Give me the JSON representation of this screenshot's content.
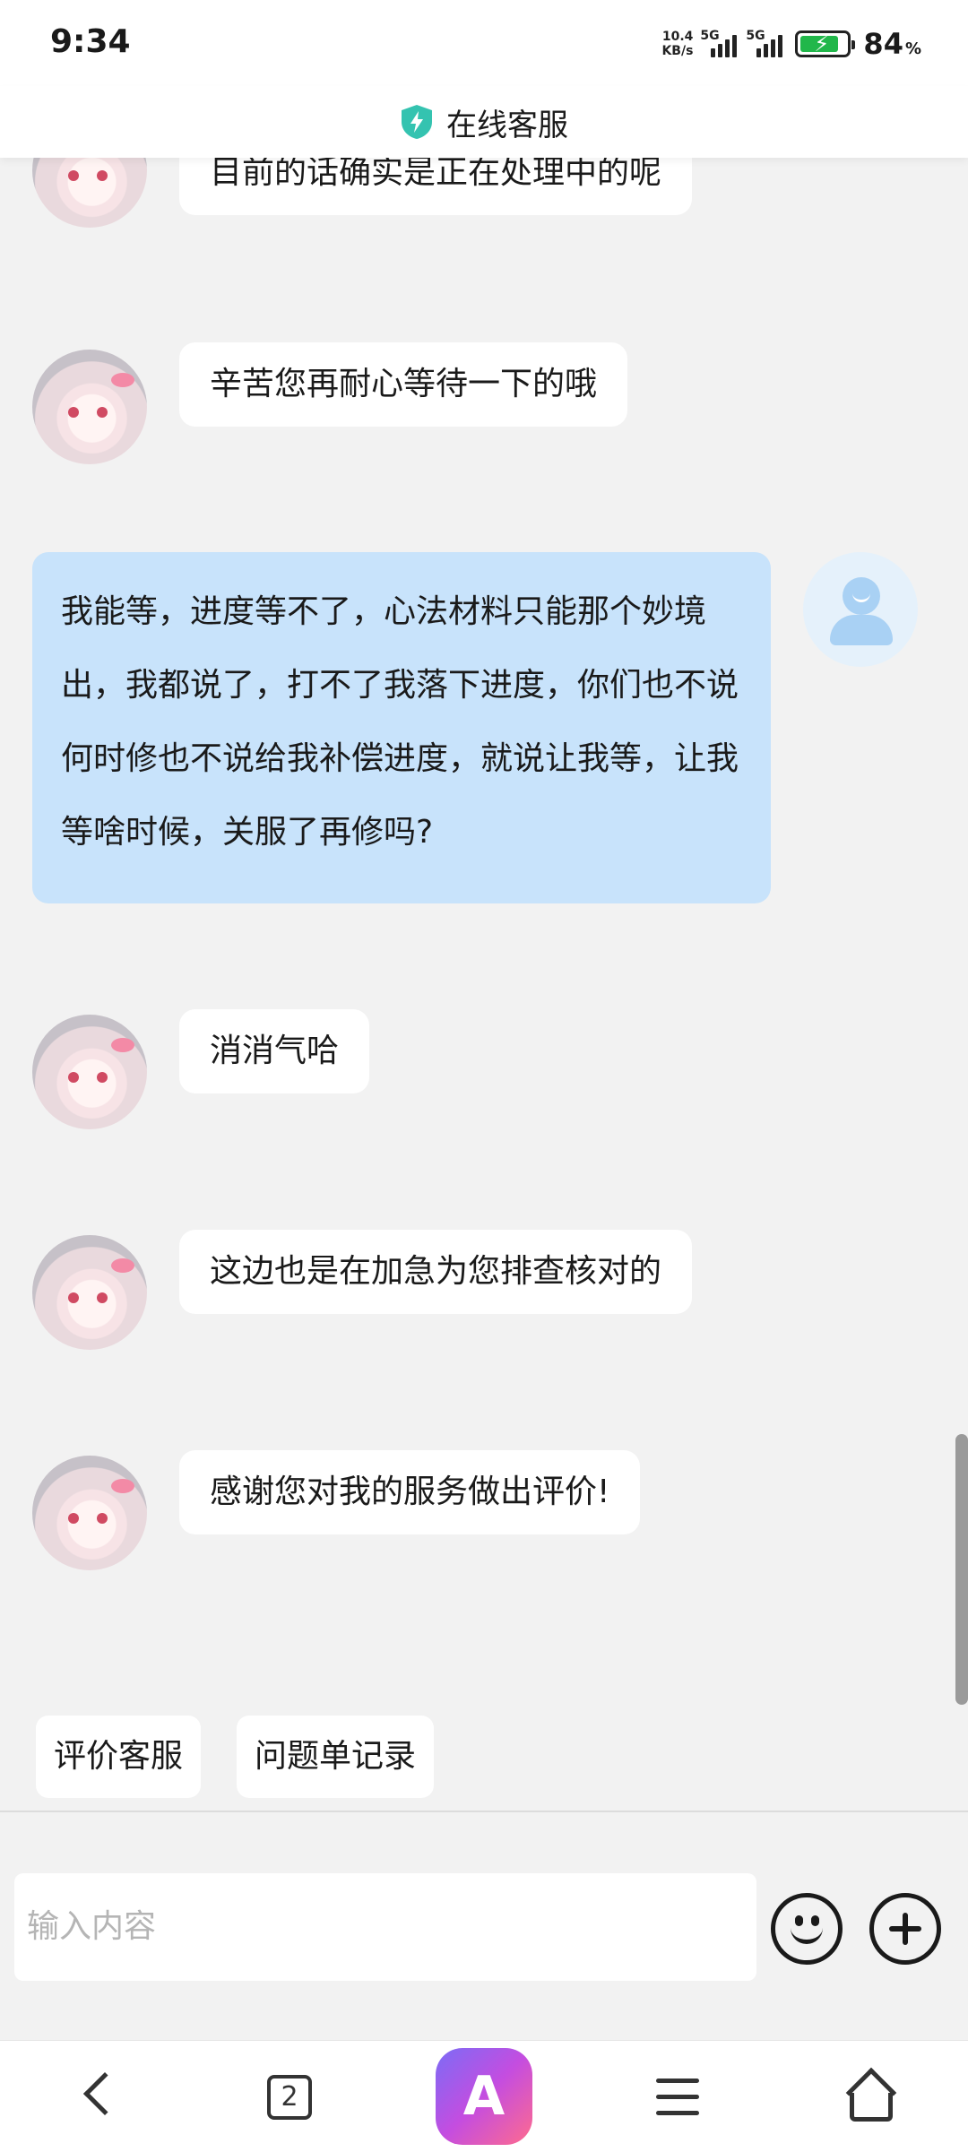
{
  "status_bar": {
    "time": "9:34",
    "net_speed_value": "10.4",
    "net_speed_unit": "KB/s",
    "signal_1": "5G",
    "signal_2": "5G",
    "battery_percent": "84",
    "battery_unit": "%",
    "battery_level": 0.84,
    "battery_color": "#21b74a"
  },
  "header": {
    "title": "在线客服",
    "icon": "shield-bolt-icon",
    "icon_color": "#34c3b0"
  },
  "messages": [
    {
      "sender": "agent",
      "text": "目前的话确实是正在处理中的呢"
    },
    {
      "sender": "agent",
      "text": "辛苦您再耐心等待一下的哦"
    },
    {
      "sender": "user",
      "text": "我能等，进度等不了，心法材料只能那个妙境出，我都说了，打不了我落下进度，你们也不说何时修也不说给我补偿进度，就说让我等，让我等啥时候，关服了再修吗?"
    },
    {
      "sender": "agent",
      "text": "消消气哈"
    },
    {
      "sender": "agent",
      "text": "这边也是在加急为您排查核对的"
    },
    {
      "sender": "agent",
      "text": "感谢您对我的服务做出评价!"
    }
  ],
  "quick_actions": [
    {
      "label": "评价客服"
    },
    {
      "label": "问题单记录"
    }
  ],
  "input": {
    "placeholder": "输入内容",
    "value": ""
  },
  "input_buttons": {
    "emoji": "emoji-icon",
    "add": "plus-circle-icon"
  },
  "bottom_nav": {
    "tab_count": "2",
    "app_logo": "A",
    "items": [
      "back-icon",
      "tabs-icon",
      "browser-logo-icon",
      "menu-icon",
      "home-icon"
    ]
  },
  "colors": {
    "user_bubble": "#c8e3fb",
    "agent_bubble": "#ffffff",
    "background": "#f2f2f2"
  }
}
